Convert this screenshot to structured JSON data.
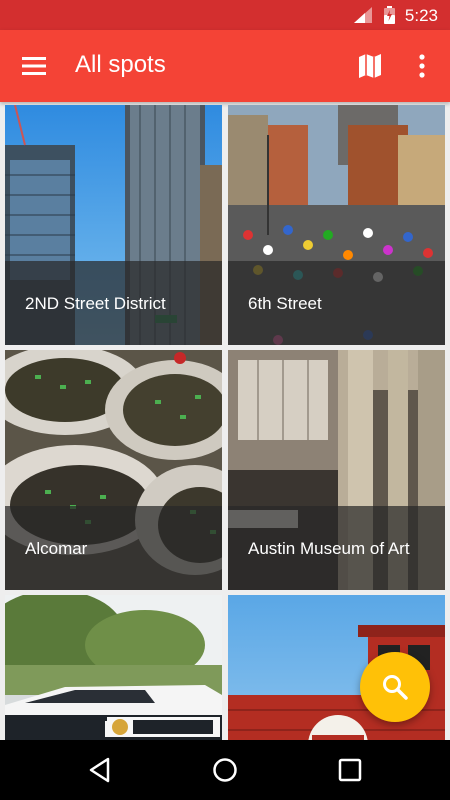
{
  "status_bar": {
    "time": "5:23"
  },
  "app_bar": {
    "title": "All spots",
    "icons": [
      "menu-icon",
      "map-icon",
      "more-vert-icon"
    ]
  },
  "spots": [
    {
      "name": "2ND Street District"
    },
    {
      "name": "6th Street"
    },
    {
      "name": "Alcomar"
    },
    {
      "name": "Austin Museum of Art"
    },
    {
      "name": ""
    },
    {
      "name": ""
    }
  ],
  "fab": {
    "icon": "search-icon",
    "color": "#ffc107"
  },
  "nav_bar": {
    "icons": [
      "back-icon",
      "home-icon",
      "recents-icon"
    ]
  },
  "colors": {
    "primary": "#f44336",
    "primary_dark": "#d32f2f",
    "accent": "#ffc107"
  }
}
